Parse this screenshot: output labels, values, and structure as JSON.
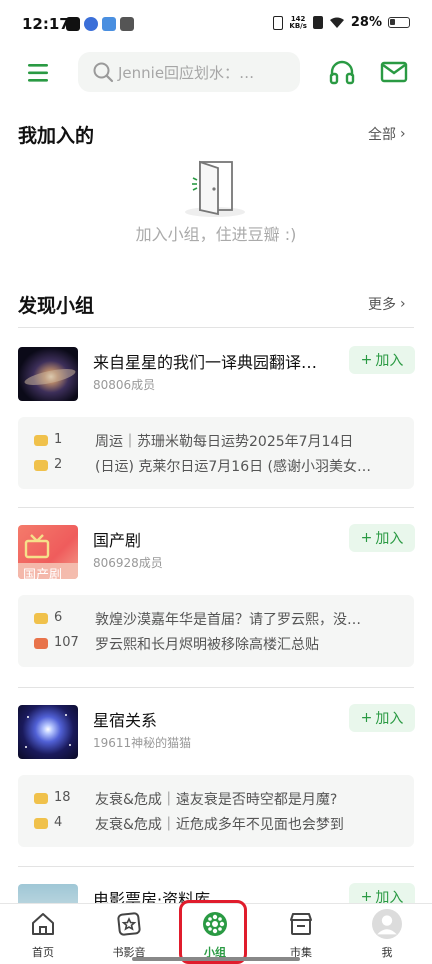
{
  "status_bar": {
    "time": "12:17",
    "net_speed_value": "142",
    "net_speed_unit": "KB/s",
    "battery": "28%"
  },
  "header": {
    "search_placeholder": "Jennie回应划水：…"
  },
  "joined": {
    "title": "我加入的",
    "more": "全部",
    "empty_text": "加入小组，住进豆瓣 :)"
  },
  "discover": {
    "title": "发现小组",
    "more": "更多",
    "join_label": "加入",
    "groups": [
      {
        "name": "来自星星的我们一译典园翻译…",
        "members": "80806成员",
        "posts": [
          {
            "count": "1",
            "title": "周运｜苏珊米勒每日运势2025年7月14日",
            "bubble_color": "#f0c14b"
          },
          {
            "count": "2",
            "title": "(日运) 克莱尔日运7月16日 (感谢小羽美女…",
            "bubble_color": "#f0c14b"
          }
        ]
      },
      {
        "name": "国产剧",
        "members": "806928成员",
        "thumb_text": "国产剧",
        "posts": [
          {
            "count": "6",
            "title": "敦煌沙漠嘉年华是首届？请了罗云熙，没…",
            "bubble_color": "#f0c14b"
          },
          {
            "count": "107",
            "title": "罗云熙和长月烬明被移除高楼汇总贴",
            "bubble_color": "#e8734a"
          }
        ]
      },
      {
        "name": "星宿关系",
        "members": "19611神秘的猫猫",
        "posts": [
          {
            "count": "18",
            "title": "友衰&危成｜遠友衰是否時空都是月魔?",
            "bubble_color": "#f0c14b"
          },
          {
            "count": "4",
            "title": "友衰&危成｜近危成多年不见面也会梦到",
            "bubble_color": "#f0c14b"
          }
        ]
      },
      {
        "name": "电影票房·资料库",
        "members": "",
        "posts": []
      }
    ]
  },
  "bottom_nav": [
    {
      "label": "首页"
    },
    {
      "label": "书影音"
    },
    {
      "label": "小组"
    },
    {
      "label": "市集"
    },
    {
      "label": "我"
    }
  ],
  "colors": {
    "brand_green": "#2a9a43",
    "join_bg": "#e9f7ec",
    "highlight_red": "#e01c2c"
  }
}
